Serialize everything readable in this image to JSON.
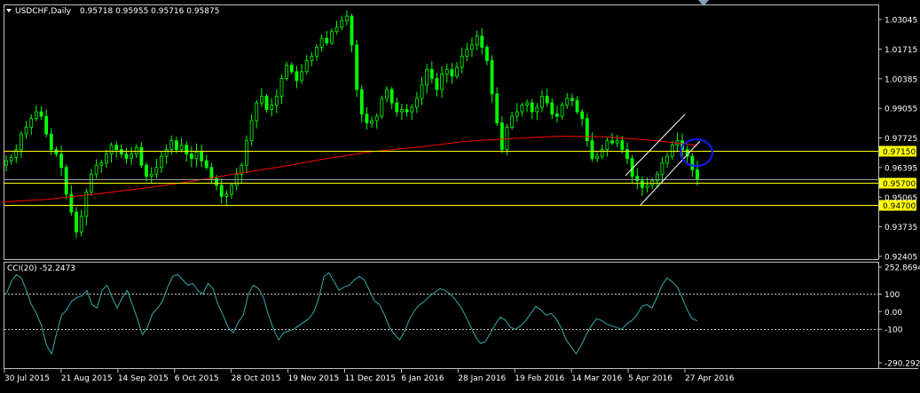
{
  "header": {
    "symbol": "USDCHF,Daily",
    "ohlc": "0.95718 0.95955 0.95716 0.95875",
    "menu_arrow": "triangle-down-icon"
  },
  "indicator": {
    "label": "CCI(20) -52.2473"
  },
  "colors": {
    "background": "#000000",
    "candle": "#00ff00",
    "moving_average": "#ff0000",
    "hline": "#ffff00",
    "channel": "#ffffff",
    "circle": "#0000ff",
    "cci": "#33aaaa",
    "grid_text": "#ffffff",
    "border": "#c0c0c0"
  },
  "chart_data": [
    {
      "type": "candlestick",
      "series": [
        {
          "name": "USDCHF,Daily",
          "close": [
            0.967,
            0.9685,
            0.972,
            0.979,
            0.982,
            0.986,
            0.989,
            0.987,
            0.979,
            0.972,
            0.97,
            0.964,
            0.952,
            0.944,
            0.935,
            0.942,
            0.953,
            0.961,
            0.965,
            0.966,
            0.97,
            0.974,
            0.972,
            0.97,
            0.968,
            0.97,
            0.973,
            0.965,
            0.96,
            0.961,
            0.964,
            0.969,
            0.972,
            0.976,
            0.972,
            0.974,
            0.97,
            0.968,
            0.971,
            0.967,
            0.964,
            0.959,
            0.956,
            0.951,
            0.952,
            0.956,
            0.961,
            0.965,
            0.976,
            0.985,
            0.993,
            0.996,
            0.99,
            0.992,
            0.996,
            1.004,
            1.01,
            1.007,
            1.003,
            1.007,
            1.012,
            1.014,
            1.018,
            1.022,
            1.02,
            1.025,
            1.027,
            1.03,
            1.032,
            1.019,
            0.999,
            0.988,
            0.984,
            0.985,
            0.987,
            0.995,
            0.999,
            0.993,
            0.989,
            0.99,
            0.989,
            0.991,
            0.995,
            1.001,
            1.008,
            1.004,
            0.999,
            1.006,
            1.008,
            1.005,
            1.009,
            1.014,
            1.017,
            1.019,
            1.023,
            1.018,
            1.012,
            0.997,
            0.984,
            0.972,
            0.982,
            0.987,
            0.989,
            0.992,
            0.993,
            0.989,
            0.991,
            0.996,
            0.993,
            0.988,
            0.987,
            0.992,
            0.995,
            0.994,
            0.989,
            0.986,
            0.976,
            0.968,
            0.969,
            0.972,
            0.976,
            0.975,
            0.976,
            0.972,
            0.968,
            0.96,
            0.958,
            0.955,
            0.956,
            0.958,
            0.961,
            0.966,
            0.969,
            0.974,
            0.976,
            0.972,
            0.969,
            0.963,
            0.9587
          ]
        },
        {
          "name": "MA",
          "values": [
            0.9485,
            0.9497,
            0.952,
            0.9545,
            0.9575,
            0.961,
            0.9642,
            0.968,
            0.9712,
            0.9732,
            0.9757,
            0.977,
            0.978,
            0.9778,
            0.9762,
            0.974
          ]
        }
      ],
      "xlabels": [
        "30 Jul 2015",
        "21 Aug 2015",
        "14 Sep 2015",
        "6 Oct 2015",
        "28 Oct 2015",
        "19 Nov 2015",
        "11 Dec 2015",
        "6 Jan 2016",
        "28 Jan 2016",
        "19 Feb 2016",
        "14 Mar 2016",
        "5 Apr 2016",
        "27 Apr 2016"
      ],
      "ylabels": [
        "1.03045",
        "1.01715",
        "1.00385",
        "0.99055",
        "0.97725",
        "0.96395",
        "0.95065",
        "0.93735",
        "0.92405"
      ],
      "ylim": [
        0.9208,
        1.037
      ],
      "hlines": [
        {
          "value": 0.9715,
          "label": "0.97150"
        },
        {
          "value": 0.957,
          "label": "0.95700"
        },
        {
          "value": 0.947,
          "label": "0.94700"
        }
      ],
      "grid": false
    },
    {
      "type": "line",
      "series": [
        {
          "name": "CCI(20) -52.2473",
          "values": [
            100,
            170,
            210,
            190,
            120,
            40,
            -10,
            -80,
            -190,
            -240,
            -120,
            -20,
            10,
            60,
            80,
            90,
            120,
            40,
            20,
            120,
            150,
            80,
            20,
            80,
            120,
            40,
            -40,
            -130,
            -90,
            -10,
            20,
            60,
            140,
            200,
            210,
            180,
            150,
            160,
            120,
            100,
            160,
            130,
            40,
            -20,
            -90,
            -120,
            -60,
            -20,
            100,
            150,
            130,
            80,
            -20,
            -100,
            -160,
            -120,
            -110,
            -100,
            -80,
            -60,
            -40,
            0,
            80,
            200,
            220,
            170,
            120,
            140,
            150,
            180,
            200,
            180,
            120,
            60,
            40,
            -20,
            -90,
            -130,
            -160,
            -110,
            -40,
            10,
            40,
            60,
            90,
            110,
            130,
            120,
            100,
            70,
            30,
            -20,
            -80,
            -140,
            -180,
            -170,
            -120,
            -70,
            -30,
            -50,
            -90,
            -100,
            -80,
            -50,
            -10,
            30,
            10,
            -20,
            -10,
            -40,
            -90,
            -160,
            -200,
            -240,
            -190,
            -130,
            -80,
            -40,
            -50,
            -70,
            -80,
            -90,
            -100,
            -70,
            -50,
            -20,
            30,
            40,
            20,
            80,
            150,
            190,
            170,
            140,
            80,
            10,
            -40,
            -52
          ]
        }
      ],
      "ylabels": [
        "252.8694",
        "100",
        "0.00",
        "-100",
        "-290.2926"
      ],
      "ylim": [
        -290.2926,
        252.8694
      ],
      "hlines": [
        100,
        -100
      ],
      "grid": false
    }
  ]
}
